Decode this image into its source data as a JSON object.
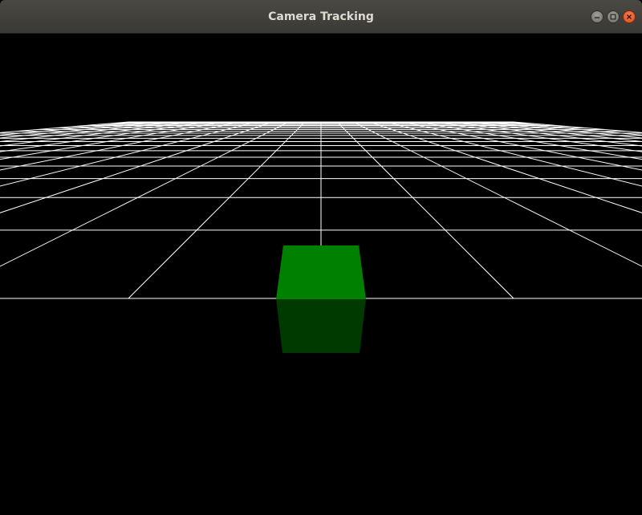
{
  "window": {
    "title": "Camera Tracking",
    "controls": [
      {
        "name": "minimize",
        "icon": "minimize-icon"
      },
      {
        "name": "maximize",
        "icon": "maximize-icon"
      },
      {
        "name": "close",
        "icon": "close-icon"
      }
    ]
  },
  "scene": {
    "background_color": "#000000",
    "grid_color": "#ffffff",
    "cube_color": "#008000",
    "cube_reflection_color": "#003a00"
  }
}
